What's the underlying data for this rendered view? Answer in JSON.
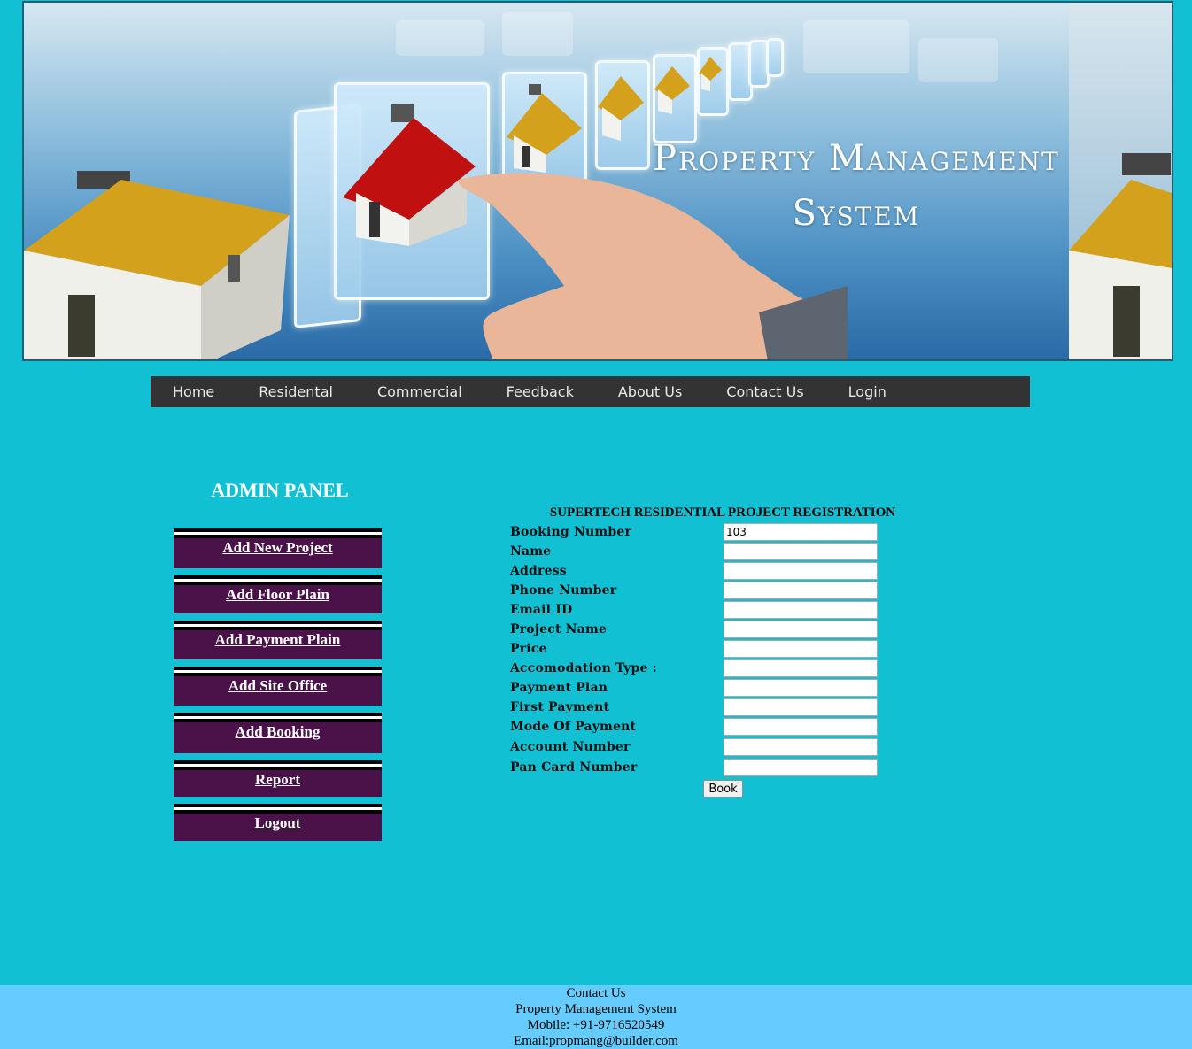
{
  "banner": {
    "title_line1": "Property Management",
    "title_line2": "System"
  },
  "nav": {
    "items": [
      "Home",
      "Residental",
      "Commercial",
      "Feedback",
      "About Us",
      "Contact Us",
      "Login"
    ]
  },
  "admin": {
    "title": "ADMIN PANEL",
    "buttons": [
      "Add New Project",
      "Add Floor Plain",
      "Add Payment Plain",
      "Add Site Office",
      "Add Booking",
      "Report",
      "Logout"
    ]
  },
  "form": {
    "title": "SUPERTECH RESIDENTIAL PROJECT REGISTRATION",
    "fields": [
      {
        "label": "Booking Number",
        "value": "103"
      },
      {
        "label": "Name",
        "value": ""
      },
      {
        "label": "Address",
        "value": ""
      },
      {
        "label": "Phone Number",
        "value": ""
      },
      {
        "label": "Email ID",
        "value": ""
      },
      {
        "label": "Project Name",
        "value": ""
      },
      {
        "label": "Price",
        "value": ""
      },
      {
        "label": "Accomodation Type :",
        "value": ""
      },
      {
        "label": "Payment Plan",
        "value": ""
      },
      {
        "label": "First Payment",
        "value": ""
      },
      {
        "label": "Mode Of Payment",
        "value": ""
      },
      {
        "label": "Account Number",
        "value": ""
      },
      {
        "label": "Pan Card Number",
        "value": ""
      }
    ],
    "submit_label": "Book"
  },
  "footer": {
    "line1": "Contact Us",
    "line2": "Property Management System",
    "line3": "Mobile: +91-9716520549",
    "line4": "Email:propmang@builder.com"
  },
  "colors": {
    "page_bg": "#12c0d3",
    "nav_bg": "#333333",
    "admin_button_bg": "#4b1249",
    "footer_bg": "#66ccff"
  }
}
